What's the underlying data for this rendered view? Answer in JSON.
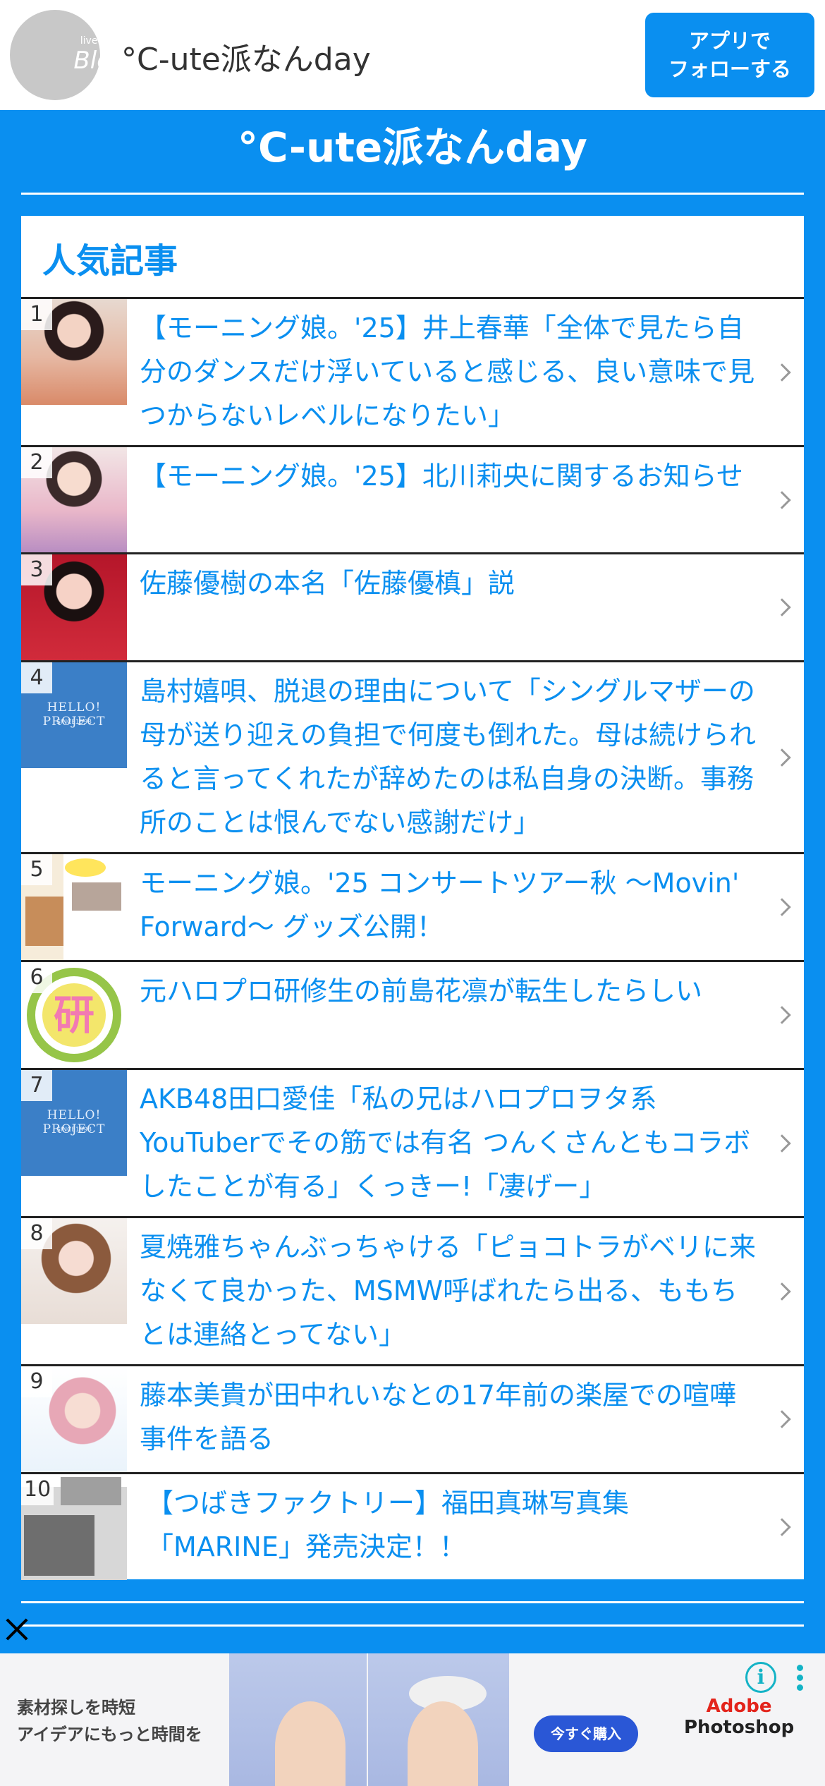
{
  "app_bar": {
    "logo_small": "livedoor",
    "logo_big": "Blog",
    "title": "°C-ute派なんday",
    "follow_line1": "アプリで",
    "follow_line2": "フォローする"
  },
  "blog": {
    "title": "°C-ute派なんday"
  },
  "popular": {
    "heading": "人気記事",
    "items": [
      {
        "rank": "1",
        "title": "【モーニング娘。'25】井上春華「全体で見たら自分のダンスだけ浮いていると感じる、良い意味で見つからないレベルになりたい」"
      },
      {
        "rank": "2",
        "title": "【モーニング娘。'25】北川莉央に関するお知らせ"
      },
      {
        "rank": "3",
        "title": "佐藤優樹の本名「佐藤優槙」説"
      },
      {
        "rank": "4",
        "title": "島村嬉唄、脱退の理由について「シングルマザーの母が送り迎えの負担で何度も倒れた。母は続けられると言ってくれたが辞めたのは私自身の決断。事務所のことは恨んでない感謝だけ」"
      },
      {
        "rank": "5",
        "title": "モーニング娘。'25 コンサートツアー秋 ～Movin' Forward～ グッズ公開！"
      },
      {
        "rank": "6",
        "title": "元ハロプロ研修生の前島花凛が転生したらしい"
      },
      {
        "rank": "7",
        "title": "AKB48田口愛佳「私の兄はハロプロヲタ系YouTuberでその筋では有名 つんくさんともコラボしたことが有る」くっきー!「凄げー」"
      },
      {
        "rank": "8",
        "title": "夏焼雅ちゃんぶっちゃける「ピョコトラがベリに来なくて良かった、MSMW呼ばれたら出る、ももちとは連絡とってない」"
      },
      {
        "rank": "9",
        "title": "藤本美貴が田中れいなとの17年前の楽屋での喧嘩事件を語る"
      },
      {
        "rank": "10",
        "title": "【つばきファクトリー】福田真琳写真集「MARINE」発売決定！！"
      }
    ],
    "thumb_texts": {
      "hp_line1": "HELLO! PROJECT",
      "hp_line2": "SINCE1998",
      "ken": "研"
    }
  },
  "ad": {
    "copy_line1": "素材探しを時短",
    "copy_line2": "アイデアにもっと時間を",
    "button": "今すぐ購入",
    "brand_line1": "Adobe",
    "brand_line2": "Photoshop",
    "info": "i"
  }
}
